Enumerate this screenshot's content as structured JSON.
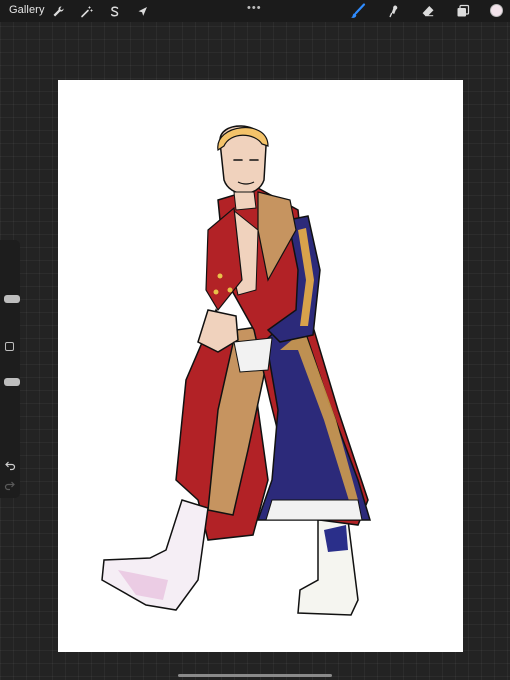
{
  "topbar": {
    "gallery_label": "Gallery",
    "left_tools": [
      "wrench-icon",
      "magic-wand-icon",
      "selection-s-icon",
      "transform-arrow-icon"
    ],
    "right_tools": [
      "brush-icon",
      "smudge-icon",
      "eraser-icon",
      "layers-icon"
    ],
    "active_tool": "brush-icon",
    "accent_color": "#2f8cff",
    "current_color": "#f4e4ec"
  },
  "sidebar": {
    "brush_size_level": 0.28,
    "opacity_level": 0.36
  },
  "canvas": {
    "background": "#ffffff",
    "subject": "illustration-figure"
  }
}
